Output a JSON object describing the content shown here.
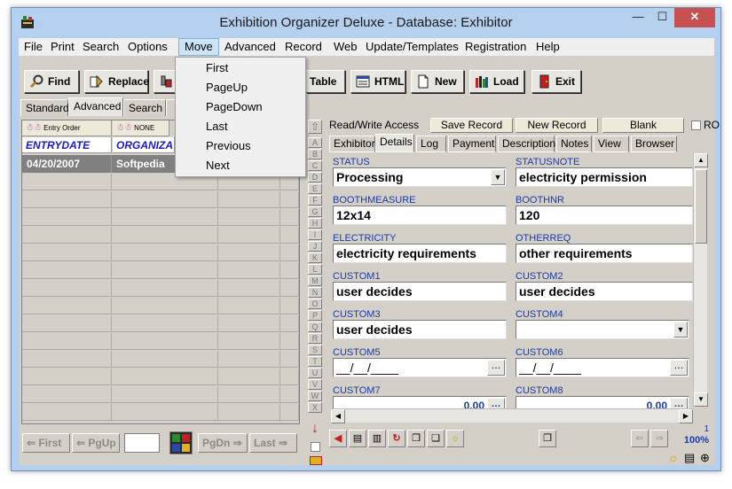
{
  "window": {
    "title": "Exhibition Organizer Deluxe - Database: Exhibitor",
    "min": "—",
    "max": "☐",
    "close": "✕"
  },
  "menu": [
    "File",
    "Print",
    "Search",
    "Options",
    "Move",
    "Advanced",
    "Record",
    "Web",
    "Update/Templates",
    "Registration",
    "Help"
  ],
  "toolbar": {
    "find": "Find",
    "replace": "Replace",
    "table": "Table",
    "html": "HTML",
    "new": "New",
    "load": "Load",
    "exit": "Exit"
  },
  "left_tabs": [
    "Standard",
    "Advanced",
    "Search"
  ],
  "grid": {
    "sort1": "Entry Order",
    "sort2": "NONE",
    "col1": "ENTRYDATE",
    "col2": "ORGANIZA",
    "row1_date": "04/20/2007",
    "row1_org": "Softpedia"
  },
  "nav": {
    "first": "First",
    "pgup": "PgUp",
    "pgdn": "PgDn",
    "last": "Last"
  },
  "letters": [
    "A",
    "B",
    "C",
    "D",
    "E",
    "F",
    "G",
    "H",
    "I",
    "J",
    "K",
    "L",
    "M",
    "N",
    "O",
    "P",
    "Q",
    "R",
    "S",
    "T",
    "U",
    "V",
    "W",
    "X"
  ],
  "record_bar": {
    "access": "Read/Write Access",
    "save": "Save Record",
    "new": "New Record",
    "blank": "Blank",
    "ro": "RO"
  },
  "right_tabs": [
    "Exhibitor",
    "Details",
    "Log",
    "Payment",
    "Description",
    "Notes",
    "View",
    "Browser"
  ],
  "fields": {
    "status_label": "STATUS",
    "status_value": "Processing",
    "statusnote_label": "STATUSNOTE",
    "statusnote_value": "electricity permission",
    "boothmeasure_label": "BOOTHMEASURE",
    "boothmeasure_value": "12x14",
    "boothnr_label": "BOOTHNR",
    "boothnr_value": "120",
    "electricity_label": "ELECTRICITY",
    "electricity_value": "electricity requirements",
    "otherreq_label": "OTHERREQ",
    "otherreq_value": "other requirements",
    "custom1_label": "CUSTOM1",
    "custom1_value": "user decides",
    "custom2_label": "CUSTOM2",
    "custom2_value": "user decides",
    "custom3_label": "CUSTOM3",
    "custom3_value": "user decides",
    "custom4_label": "CUSTOM4",
    "custom4_value": "",
    "custom5_label": "CUSTOM5",
    "custom5_value": "__/__/____",
    "custom6_label": "CUSTOM6",
    "custom6_value": "__/__/____",
    "custom7_label": "CUSTOM7",
    "custom7_value": "0.00",
    "custom8_label": "CUSTOM8",
    "custom8_value": "0.00"
  },
  "status": {
    "count": "1",
    "zoom": "100%"
  },
  "move_menu": [
    "First",
    "PageUp",
    "PageDown",
    "Last",
    "Previous",
    "Next"
  ]
}
